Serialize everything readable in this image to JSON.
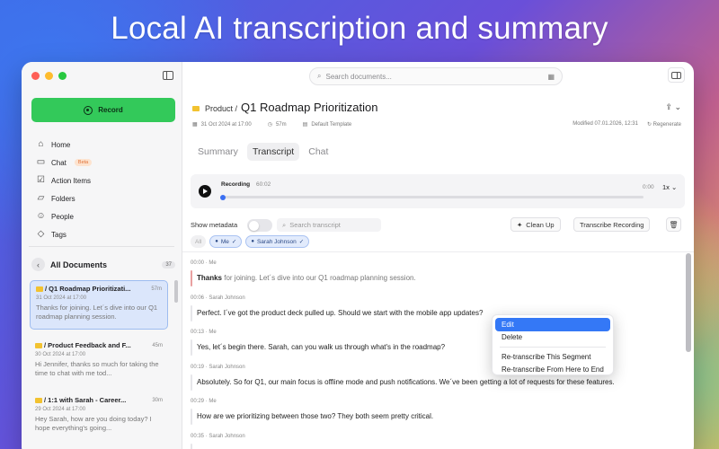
{
  "headline": "Local AI transcription and summary",
  "sidebar": {
    "record_label": "Record",
    "nav": [
      {
        "label": "Home",
        "icon": "home-icon"
      },
      {
        "label": "Chat",
        "icon": "chat-icon",
        "badge": "Beta"
      },
      {
        "label": "Action Items",
        "icon": "checklist-icon"
      },
      {
        "label": "Folders",
        "icon": "folder-icon"
      },
      {
        "label": "People",
        "icon": "people-icon"
      },
      {
        "label": "Tags",
        "icon": "tag-icon"
      }
    ],
    "all_documents_title": "All Documents",
    "all_documents_count": "37",
    "documents": [
      {
        "title": "/ Q1 Roadmap Prioritizati...",
        "duration": "57m",
        "date": "31 Oct 2024 at 17:00",
        "snippet": "Thanks for joining. Let´s dive into our Q1 roadmap planning session."
      },
      {
        "title": "/ Product Feedback and F...",
        "duration": "45m",
        "date": "30 Oct 2024 at 17:00",
        "snippet": "Hi Jennifer, thanks so much for taking the time to chat with me tod..."
      },
      {
        "title": "/ 1:1 with Sarah - Career...",
        "duration": "30m",
        "date": "29 Oct 2024 at 17:00",
        "snippet": "Hey Sarah, how are you doing today? I hope everything's going..."
      }
    ]
  },
  "main": {
    "search_placeholder": "Search documents...",
    "breadcrumb_folder": "Product /",
    "title": "Q1 Roadmap Prioritization",
    "meta": {
      "date": "31 Oct 2024 at 17:00",
      "duration": "57m",
      "template": "Default Template",
      "modified": "Modified 07.01.2026, 12:31",
      "regenerate": "Regenerate"
    },
    "tabs": [
      "Summary",
      "Transcript",
      "Chat"
    ],
    "active_tab": "Transcript",
    "player": {
      "label": "Recording",
      "time": "60:02",
      "position": "0:00",
      "speed": "1x",
      "progress": 0.0
    },
    "toolbar": {
      "show_metadata": "Show metadata",
      "search_placeholder": "Search transcript",
      "clean_up": "Clean Up",
      "transcribe": "Transcribe Recording"
    },
    "filters": {
      "all": "All",
      "speakers": [
        "Me",
        "Sarah Johnson"
      ]
    },
    "segments": [
      {
        "time": "00:00",
        "speaker": "Me",
        "text_bold": "Thanks",
        "text": " for joining. Let´s dive into our Q1 roadmap planning session.",
        "highlight": true
      },
      {
        "time": "00:06",
        "speaker": "Sarah Johnson",
        "text_bold": "",
        "text": "Perfect. I´ve got the product deck pulled up. Should we start with the mobile app updates?",
        "highlight": false
      },
      {
        "time": "00:13",
        "speaker": "Me",
        "text_bold": "",
        "text": "Yes, let´s begin there. Sarah, can you walk us through what's in the roadmap?",
        "highlight": false
      },
      {
        "time": "00:19",
        "speaker": "Sarah Johnson",
        "text_bold": "",
        "text": "Absolutely. So for Q1, our main focus is offline mode and push notifications. We´ve been getting a lot of requests for these features.",
        "highlight": false
      },
      {
        "time": "00:29",
        "speaker": "Me",
        "text_bold": "",
        "text": "How are we prioritizing between those two? They both seem pretty critical.",
        "highlight": false
      },
      {
        "time": "00:35",
        "speaker": "Sarah Johnson",
        "text_bold": "",
        "text": "",
        "highlight": false
      }
    ],
    "context_menu": {
      "items": [
        "Edit",
        "Delete"
      ],
      "items2": [
        "Re-transcribe This Segment",
        "Re-transcribe From Here to End"
      ],
      "active": "Edit"
    }
  }
}
